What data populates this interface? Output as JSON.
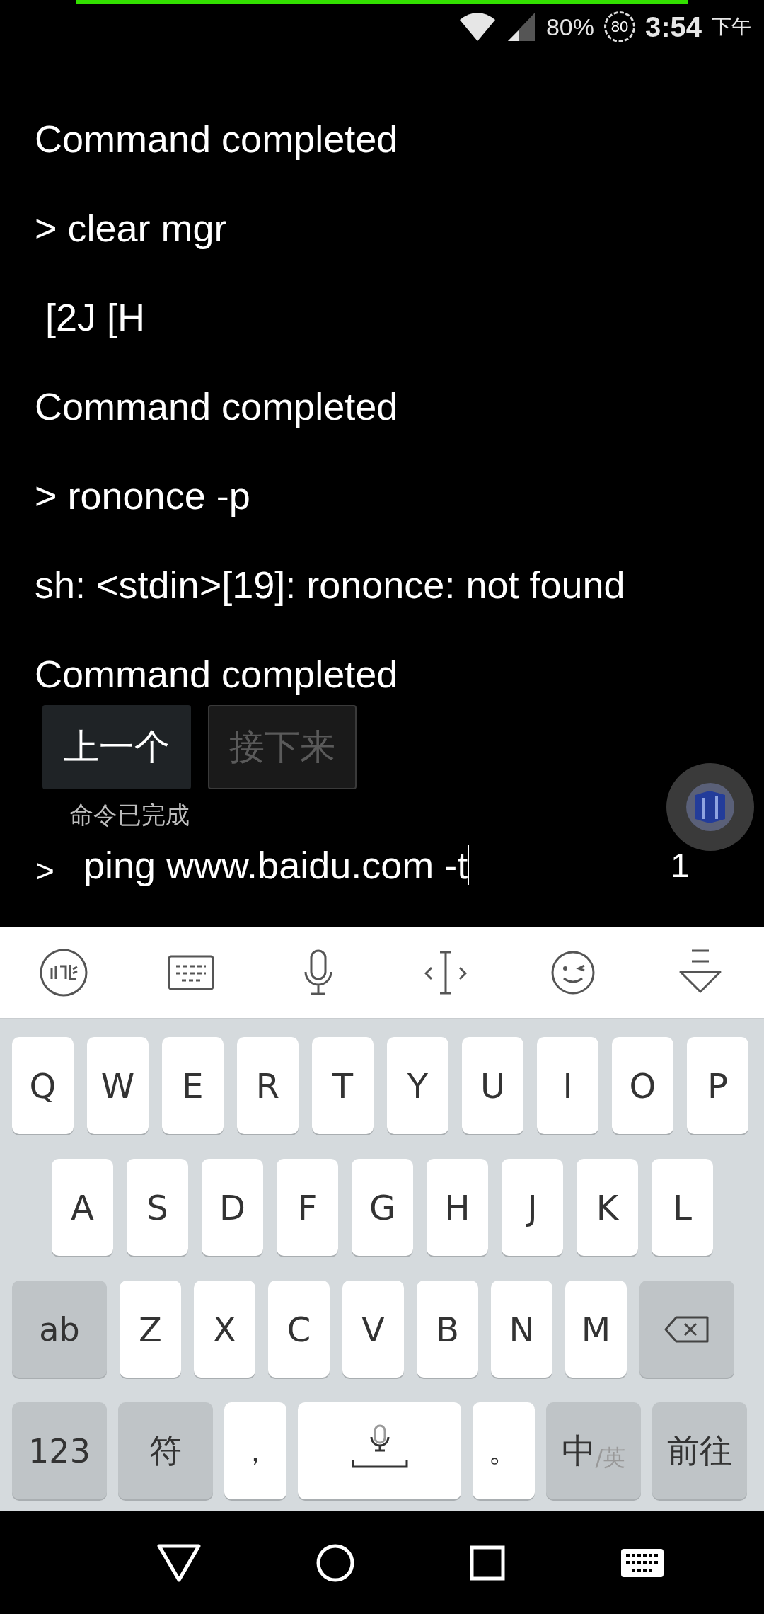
{
  "status_bar": {
    "battery": "80%",
    "battery_badge": "80",
    "time": "3:54",
    "time_suffix": "下午"
  },
  "terminal": {
    "lines": [
      "Command completed",
      "> clear mgr",
      " [2J [H",
      "Command completed",
      "> rononce -p",
      "sh: <stdin>[19]: rononce: not found",
      "Command completed"
    ]
  },
  "buttons": [
    {
      "label": "上一个",
      "disabled": false
    },
    {
      "label": "接下来",
      "disabled": true
    }
  ],
  "hint": "命令已完成",
  "input": {
    "prompt": ">",
    "value": "ping www.baidu.com -t",
    "count": "1"
  },
  "keyboard": {
    "key_rows": [
      {
        "keys": [
          {
            "kind": "letter",
            "label": "Q"
          },
          {
            "kind": "letter",
            "label": "W"
          },
          {
            "kind": "letter",
            "label": "E"
          },
          {
            "kind": "letter",
            "label": "R"
          },
          {
            "kind": "letter",
            "label": "T"
          },
          {
            "kind": "letter",
            "label": "Y"
          },
          {
            "kind": "letter",
            "label": "U"
          },
          {
            "kind": "letter",
            "label": "I"
          },
          {
            "kind": "letter",
            "label": "O"
          },
          {
            "kind": "letter",
            "label": "P"
          }
        ]
      },
      {
        "keys": [
          {
            "kind": "letter",
            "label": "A"
          },
          {
            "kind": "letter",
            "label": "S"
          },
          {
            "kind": "letter",
            "label": "D"
          },
          {
            "kind": "letter",
            "label": "F"
          },
          {
            "kind": "letter",
            "label": "G"
          },
          {
            "kind": "letter",
            "label": "H"
          },
          {
            "kind": "letter",
            "label": "J"
          },
          {
            "kind": "letter",
            "label": "K"
          },
          {
            "kind": "letter",
            "label": "L"
          }
        ]
      },
      {
        "keys": [
          {
            "kind": "function",
            "label": "ab"
          },
          {
            "kind": "letter",
            "label": "Z"
          },
          {
            "kind": "letter",
            "label": "X"
          },
          {
            "kind": "letter",
            "label": "C"
          },
          {
            "kind": "letter",
            "label": "V"
          },
          {
            "kind": "letter",
            "label": "B"
          },
          {
            "kind": "letter",
            "label": "N"
          },
          {
            "kind": "letter",
            "label": "M"
          },
          {
            "kind": "backspace"
          }
        ]
      },
      {
        "keys": [
          {
            "kind": "function",
            "label": "123"
          },
          {
            "kind": "function",
            "label": "符"
          },
          {
            "kind": "punct",
            "label": "，"
          },
          {
            "kind": "space"
          },
          {
            "kind": "punct",
            "label": "。"
          },
          {
            "kind": "lang",
            "label": "中",
            "alt": "/英"
          },
          {
            "kind": "function",
            "label": "前往"
          }
        ]
      }
    ]
  }
}
